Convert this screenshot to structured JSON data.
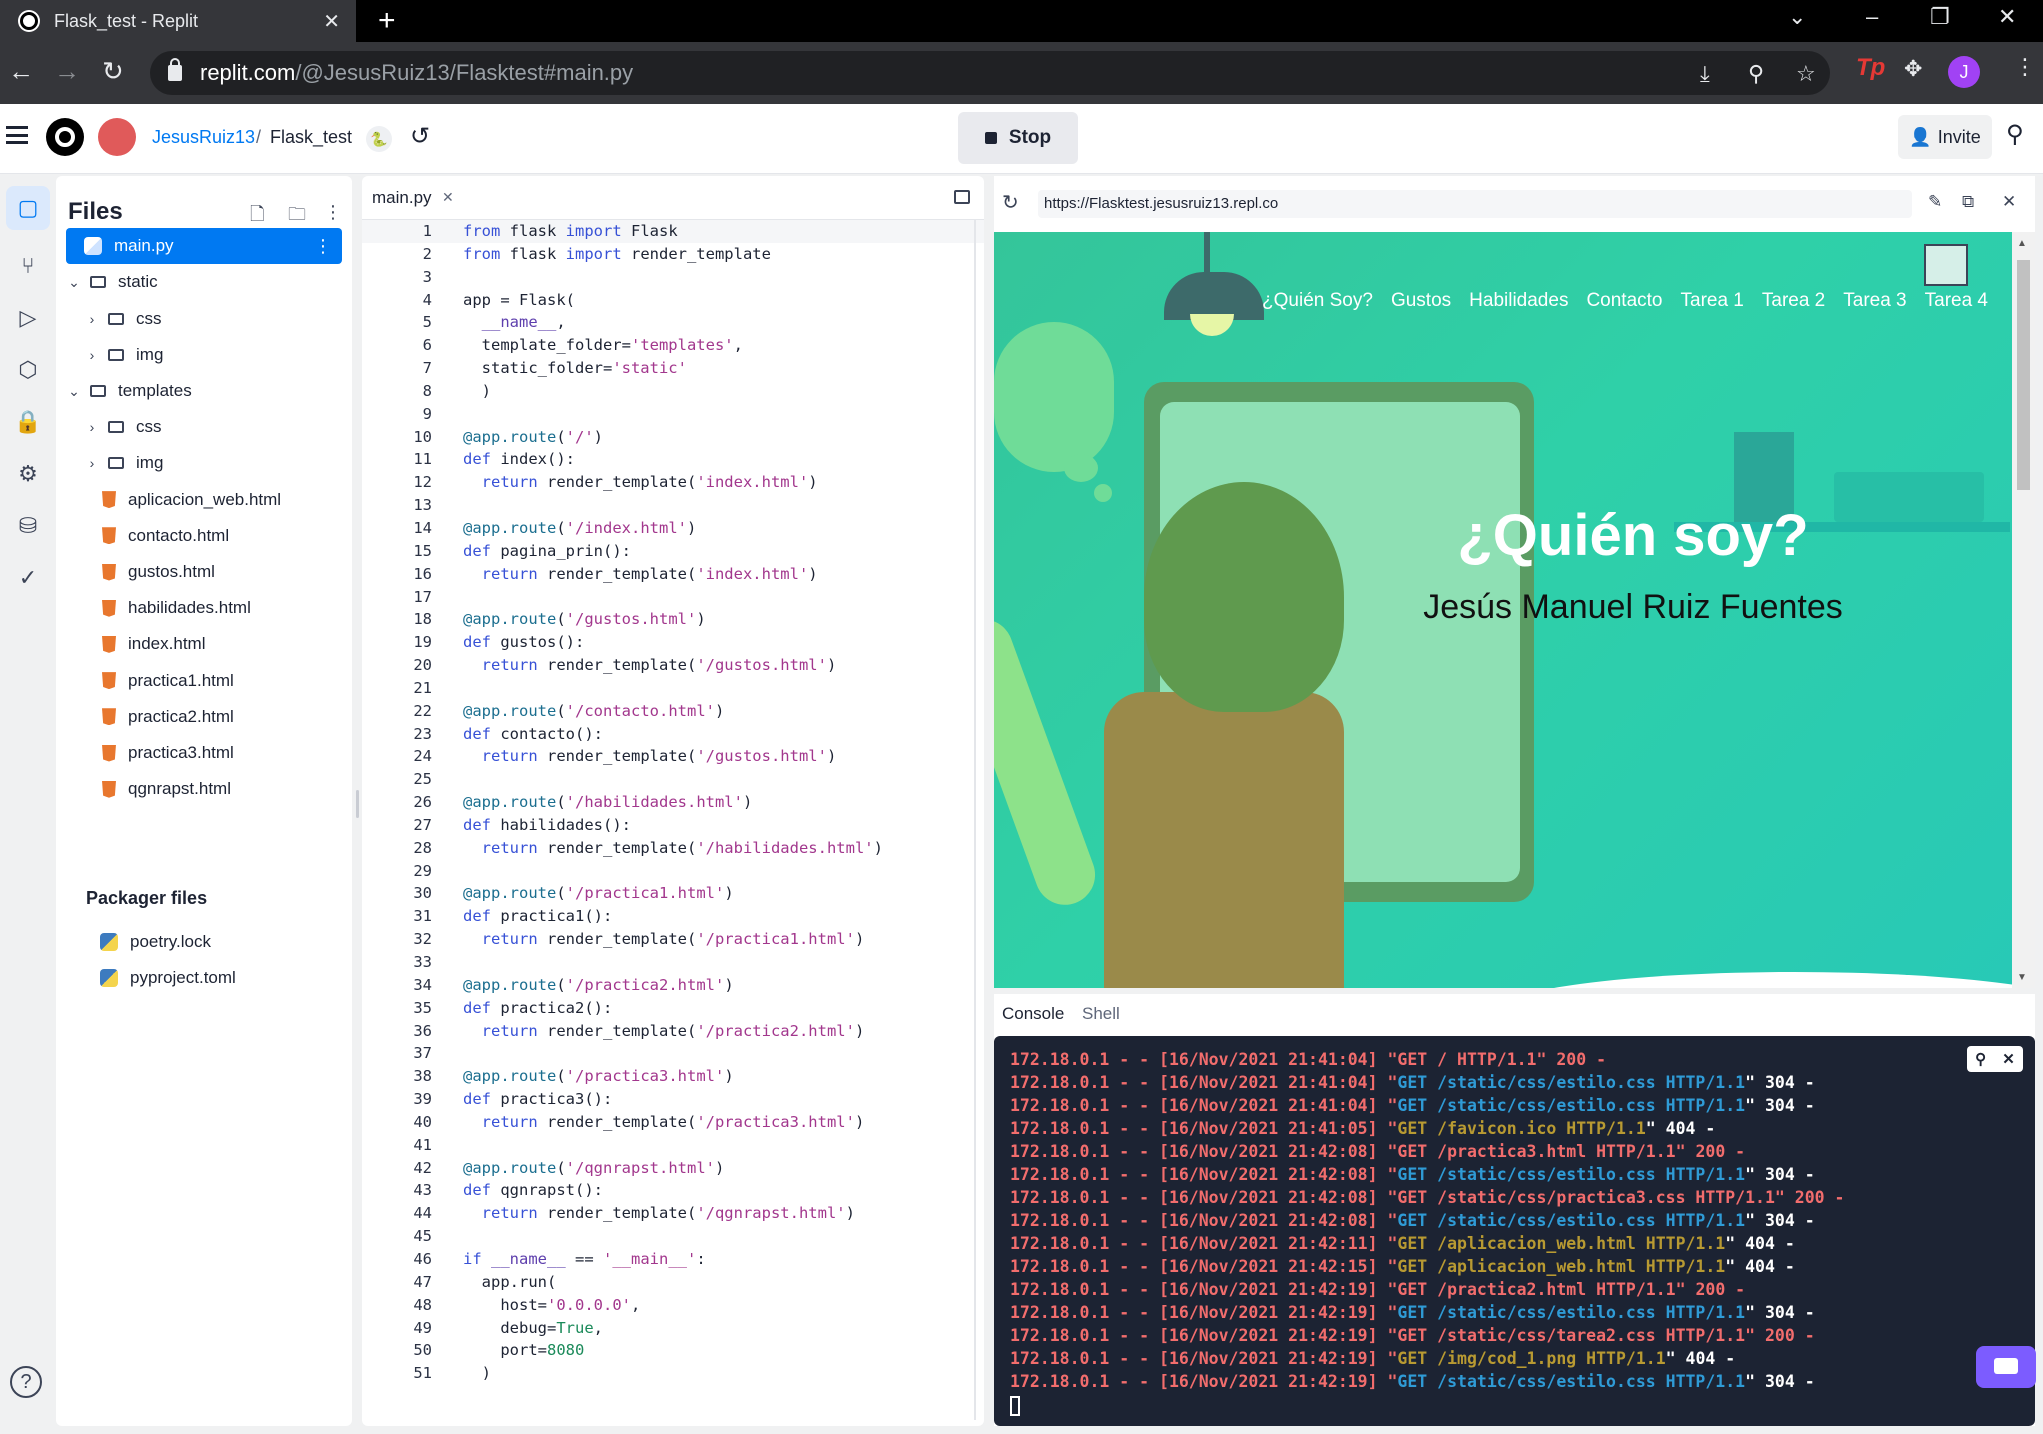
{
  "browser": {
    "tab_title": "Flask_test - Replit",
    "url_host": "replit.com",
    "url_path": "/@JesusRuiz13/Flasktest#main.py",
    "profile_initial": "J"
  },
  "header": {
    "username": "JesusRuiz13",
    "separator": "/",
    "repl_name": "Flask_test",
    "stop_label": "Stop",
    "invite_label": "Invite"
  },
  "files": {
    "title": "Files",
    "tree": [
      {
        "label": "main.py",
        "type": "py",
        "selected": true
      },
      {
        "label": "static",
        "type": "folder-open"
      },
      {
        "label": "css",
        "type": "folder"
      },
      {
        "label": "img",
        "type": "folder"
      },
      {
        "label": "templates",
        "type": "folder-open"
      },
      {
        "label": "css",
        "type": "folder"
      },
      {
        "label": "img",
        "type": "folder"
      },
      {
        "label": "aplicacion_web.html",
        "type": "html"
      },
      {
        "label": "contacto.html",
        "type": "html"
      },
      {
        "label": "gustos.html",
        "type": "html"
      },
      {
        "label": "habilidades.html",
        "type": "html"
      },
      {
        "label": "index.html",
        "type": "html"
      },
      {
        "label": "practica1.html",
        "type": "html"
      },
      {
        "label": "practica2.html",
        "type": "html"
      },
      {
        "label": "practica3.html",
        "type": "html"
      },
      {
        "label": "qgnrapst.html",
        "type": "html"
      }
    ],
    "packager_title": "Packager files",
    "packager": [
      {
        "label": "poetry.lock"
      },
      {
        "label": "pyproject.toml"
      }
    ]
  },
  "editor": {
    "tab_label": "main.py",
    "lines": [
      "from flask import Flask",
      "from flask import render_template",
      "",
      "app = Flask(",
      "  __name__,",
      "  template_folder='templates',",
      "  static_folder='static'",
      "  )",
      "",
      "@app.route('/')",
      "def index():",
      "  return render_template('index.html')",
      "",
      "@app.route('/index.html')",
      "def pagina_prin():",
      "  return render_template('index.html')",
      "",
      "@app.route('/gustos.html')",
      "def gustos():",
      "  return render_template('/gustos.html')",
      "",
      "@app.route('/contacto.html')",
      "def contacto():",
      "  return render_template('/gustos.html')",
      "",
      "@app.route('/habilidades.html')",
      "def habilidades():",
      "  return render_template('/habilidades.html')",
      "",
      "@app.route('/practica1.html')",
      "def practica1():",
      "  return render_template('/practica1.html')",
      "",
      "@app.route('/practica2.html')",
      "def practica2():",
      "  return render_template('/practica2.html')",
      "",
      "@app.route('/practica3.html')",
      "def practica3():",
      "  return render_template('/practica3.html')",
      "",
      "@app.route('/qgnrapst.html')",
      "def qgnrapst():",
      "  return render_template('/qgnrapst.html')",
      "",
      "if __name__ == '__main__':",
      "  app.run(",
      "    host='0.0.0.0',",
      "    debug=True,",
      "    port=8080",
      "  )"
    ]
  },
  "webview": {
    "url": "https://Flasktest.jesusruiz13.repl.co",
    "nav": [
      "¿Quién Soy?",
      "Gustos",
      "Habilidades",
      "Contacto",
      "Tarea 1",
      "Tarea 2",
      "Tarea 3",
      "Tarea 4"
    ],
    "heading": "¿Quién soy?",
    "subheading": "Jesús Manuel Ruiz Fuentes"
  },
  "console": {
    "tabs": [
      "Console",
      "Shell"
    ],
    "logs": [
      {
        "prefix": "172.18.0.1 - - [16/Nov/2021 21:41:04] \"",
        "msg": "GET / HTTP/1.1",
        "color": "red",
        "suffix": " 200 -",
        "quote_white": false
      },
      {
        "prefix": "172.18.0.1 - - [16/Nov/2021 21:41:04] \"",
        "msg": "GET /static/css/estilo.css HTTP/1.1",
        "color": "blue",
        "suffix": " 304 -",
        "quote_white": true
      },
      {
        "prefix": "172.18.0.1 - - [16/Nov/2021 21:41:04] \"",
        "msg": "GET /static/css/estilo.css HTTP/1.1",
        "color": "blue",
        "suffix": " 304 -",
        "quote_white": true
      },
      {
        "prefix": "172.18.0.1 - - [16/Nov/2021 21:41:05] \"",
        "msg": "GET /favicon.ico HTTP/1.1",
        "color": "yel",
        "suffix": " 404 -",
        "quote_white": true
      },
      {
        "prefix": "172.18.0.1 - - [16/Nov/2021 21:42:08] \"",
        "msg": "GET /practica3.html HTTP/1.1",
        "color": "red",
        "suffix": " 200 -",
        "quote_white": false
      },
      {
        "prefix": "172.18.0.1 - - [16/Nov/2021 21:42:08] \"",
        "msg": "GET /static/css/estilo.css HTTP/1.1",
        "color": "blue",
        "suffix": " 304 -",
        "quote_white": true
      },
      {
        "prefix": "172.18.0.1 - - [16/Nov/2021 21:42:08] \"",
        "msg": "GET /static/css/practica3.css HTTP/1.1",
        "color": "red",
        "suffix": " 200 -",
        "quote_white": false
      },
      {
        "prefix": "172.18.0.1 - - [16/Nov/2021 21:42:08] \"",
        "msg": "GET /static/css/estilo.css HTTP/1.1",
        "color": "blue",
        "suffix": " 304 -",
        "quote_white": true
      },
      {
        "prefix": "172.18.0.1 - - [16/Nov/2021 21:42:11] \"",
        "msg": "GET /aplicacion_web.html HTTP/1.1",
        "color": "yel",
        "suffix": " 404 -",
        "quote_white": true
      },
      {
        "prefix": "172.18.0.1 - - [16/Nov/2021 21:42:15] \"",
        "msg": "GET /aplicacion_web.html HTTP/1.1",
        "color": "yel",
        "suffix": " 404 -",
        "quote_white": true
      },
      {
        "prefix": "172.18.0.1 - - [16/Nov/2021 21:42:19] \"",
        "msg": "GET /practica2.html HTTP/1.1",
        "color": "red",
        "suffix": " 200 -",
        "quote_white": false
      },
      {
        "prefix": "172.18.0.1 - - [16/Nov/2021 21:42:19] \"",
        "msg": "GET /static/css/estilo.css HTTP/1.1",
        "color": "blue",
        "suffix": " 304 -",
        "quote_white": true
      },
      {
        "prefix": "172.18.0.1 - - [16/Nov/2021 21:42:19] \"",
        "msg": "GET /static/css/tarea2.css HTTP/1.1",
        "color": "red",
        "suffix": " 200 -",
        "quote_white": false
      },
      {
        "prefix": "172.18.0.1 - - [16/Nov/2021 21:42:19] \"",
        "msg": "GET /img/cod_1.png HTTP/1.1",
        "color": "yel",
        "suffix": " 404 -",
        "quote_white": true
      },
      {
        "prefix": "172.18.0.1 - - [16/Nov/2021 21:42:19] \"",
        "msg": "GET /static/css/estilo.css HTTP/1.1",
        "color": "blue",
        "suffix": " 304 -",
        "quote_white": true
      }
    ]
  },
  "colors": {
    "accent": "#0079f2",
    "site_green": "#2fd0a8",
    "console_bg": "#1c2333"
  }
}
